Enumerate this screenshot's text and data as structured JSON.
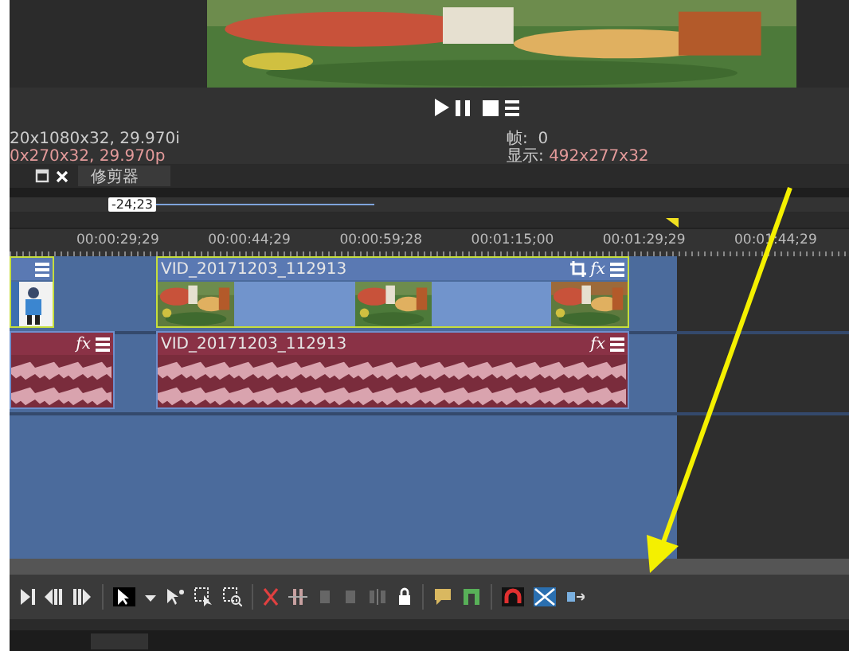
{
  "info": {
    "source_format": "20x1080x32, 29.970i",
    "project_format": "0x270x32, 29.970p",
    "frame_label": "帧:",
    "frame_value": "0",
    "display_label": "显示:",
    "display_value": "492x277x32"
  },
  "tabs": [
    {
      "label": "修剪器",
      "selected": false
    }
  ],
  "selection": {
    "duration": "-24;23"
  },
  "ruler": {
    "ticks": [
      "00:00:29;29",
      "00:00:44;29",
      "00:00:59;28",
      "00:01:15;00",
      "00:01:29;29",
      "00:01:44;29"
    ]
  },
  "tracks": [
    {
      "kind": "video",
      "clips": [
        {
          "selected": true
        },
        {
          "title": "VID_20171203_112913",
          "effects_label": "fx",
          "selected": true
        }
      ]
    },
    {
      "kind": "audio",
      "clips": [
        {
          "effects_label": "fx",
          "selected": false
        },
        {
          "title": "VID_20171203_112913",
          "effects_label": "fx",
          "selected": false
        }
      ]
    }
  ]
}
